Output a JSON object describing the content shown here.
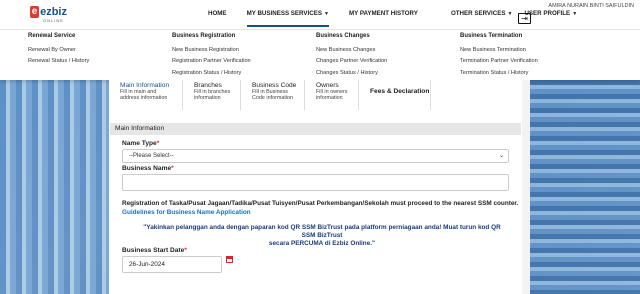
{
  "header": {
    "logo_text": "ezbiz",
    "logo_sub": "ONLINE",
    "nav": [
      {
        "label": "HOME",
        "caret": ""
      },
      {
        "label": "MY BUSINESS SERVICES",
        "caret": "▼"
      },
      {
        "label": "MY PAYMENT HISTORY",
        "caret": ""
      },
      {
        "label": "OTHER SERVICES",
        "caret": "▼"
      },
      {
        "label": "USER PROFILE",
        "caret": "▼"
      }
    ],
    "user_name": "AMIRA NURAIN BINTI SAIFULDIN",
    "logout_glyph": "⇥"
  },
  "dropdown": {
    "columns": [
      {
        "title": "Renewal Service",
        "links": [
          "Renewal By Owner",
          "Renewal Status / History"
        ]
      },
      {
        "title": "Business Registration",
        "links": [
          "New Business Registration",
          "Registration Partner Verification",
          "Registration Status / History"
        ]
      },
      {
        "title": "Business Changes",
        "links": [
          "New Business Changes",
          "Changes Partner Verification",
          "Changes Status / History"
        ]
      },
      {
        "title": "Business Termination",
        "links": [
          "New Business Termination",
          "Termination Partner Verification",
          "Termination Status / History"
        ]
      }
    ]
  },
  "steps": [
    {
      "title": "Main Information",
      "desc": [
        "Fill in main and",
        "address information"
      ]
    },
    {
      "title": "Branches",
      "desc": [
        "Fill in branches",
        "information"
      ]
    },
    {
      "title": "Business Code",
      "desc": [
        "Fill in Business",
        "Code information"
      ]
    },
    {
      "title": "Owners",
      "desc": [
        "Fill in owners",
        "information"
      ]
    },
    {
      "title": "Fees & Declaration",
      "desc": [
        "",
        ""
      ]
    }
  ],
  "form": {
    "section_title": "Main Information",
    "name_type_label": "Name Type",
    "name_type_value": "--Please Select--",
    "business_name_label": "Business Name",
    "required_mark": "*",
    "notice": "Registration of Taska/Pusat Jagaan/Tadika/Pusat Tuisyen/Pusat Perkembangan/Sekolah must proceed to the nearest SSM counter.",
    "guide_link": "Guidelines for Business Name Application",
    "promo_line1": "\"Yakinkan pelanggan anda dengan paparan kod QR SSM BizTrust pada platform perniagaan anda! Muat turun kod QR SSM BizTrust",
    "promo_line2": "secara  PERCUMA di Ezbiz Online.\"",
    "start_date_label": "Business Start Date",
    "start_date_value": "26-Jun-2024"
  },
  "colors": {
    "brand": "#1a4f8e",
    "accent_red": "#d9232d",
    "link": "#1a6fc4"
  }
}
